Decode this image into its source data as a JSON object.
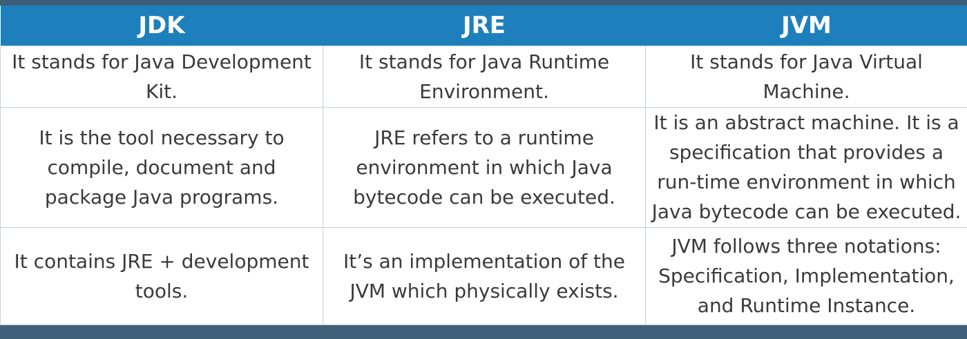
{
  "table": {
    "headers": [
      "JDK",
      "JRE",
      "JVM"
    ],
    "rows": [
      [
        "It stands for Java Development Kit.",
        "It stands for Java Runtime Environment.",
        "It stands for Java Virtual Machine."
      ],
      [
        "It is the tool necessary to compile, document and package Java programs.",
        "JRE refers to a runtime environment in which Java bytecode can be executed.",
        "It is an abstract machine. It is a specification that provides a run-time environment in which Java bytecode can be executed."
      ],
      [
        "It contains JRE + development tools.",
        "It’s an implementation of the JVM which physically exists.",
        "JVM follows three notations: Specification, Implementation, and Runtime Instance."
      ]
    ]
  },
  "colors": {
    "header_bg": "#1d80bd",
    "header_text": "#ffffff",
    "frame": "#3e5f78",
    "cell_text": "#3a3a3a",
    "grid": "#c9d1d8"
  }
}
